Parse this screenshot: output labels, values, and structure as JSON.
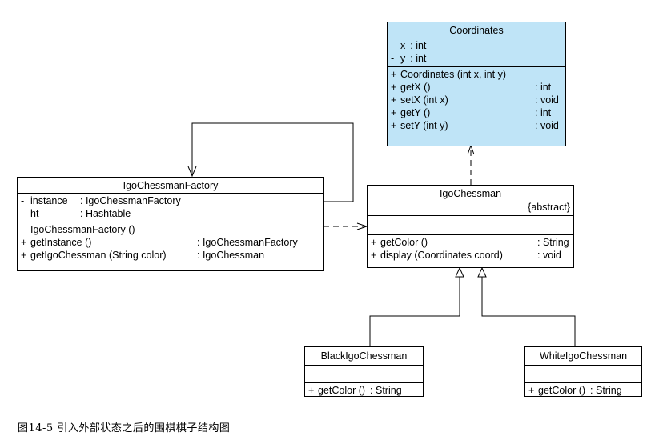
{
  "classes": {
    "coordinates": {
      "name": "Coordinates",
      "attributes": [
        {
          "vis": "-",
          "name": "x",
          "type": ": int"
        },
        {
          "vis": "-",
          "name": "y",
          "type": ": int"
        }
      ],
      "operations": [
        {
          "vis": "+",
          "name": "Coordinates (int x, int y)",
          "type": ""
        },
        {
          "vis": "+",
          "name": "getX ()",
          "type": ": int"
        },
        {
          "vis": "+",
          "name": "setX (int x)",
          "type": ": void"
        },
        {
          "vis": "+",
          "name": "getY ()",
          "type": ": int"
        },
        {
          "vis": "+",
          "name": "setY (int y)",
          "type": ": void"
        }
      ]
    },
    "factory": {
      "name": "IgoChessmanFactory",
      "attributes": [
        {
          "vis": "-",
          "name": "instance",
          "type": ": IgoChessmanFactory"
        },
        {
          "vis": "-",
          "name": "ht",
          "type": ": Hashtable"
        }
      ],
      "operations": [
        {
          "vis": "-",
          "name": "IgoChessmanFactory ()",
          "type": ""
        },
        {
          "vis": "+",
          "name": "getInstance ()",
          "type": ": IgoChessmanFactory"
        },
        {
          "vis": "+",
          "name": "getIgoChessman (String color)",
          "type": ": IgoChessman"
        }
      ]
    },
    "chessman": {
      "name": "IgoChessman",
      "stereotype": "{abstract}",
      "operations": [
        {
          "vis": "+",
          "name": "getColor ()",
          "type": ": String"
        },
        {
          "vis": "+",
          "name": "display (Coordinates coord)",
          "type": ": void"
        }
      ]
    },
    "black": {
      "name": "BlackIgoChessman",
      "operations": [
        {
          "vis": "+",
          "name": "getColor ()",
          "type": ": String"
        }
      ]
    },
    "white": {
      "name": "WhiteIgoChessman",
      "operations": [
        {
          "vis": "+",
          "name": "getColor ()",
          "type": ": String"
        }
      ]
    }
  },
  "caption": "图14-5 引入外部状态之后的围棋棋子结构图"
}
